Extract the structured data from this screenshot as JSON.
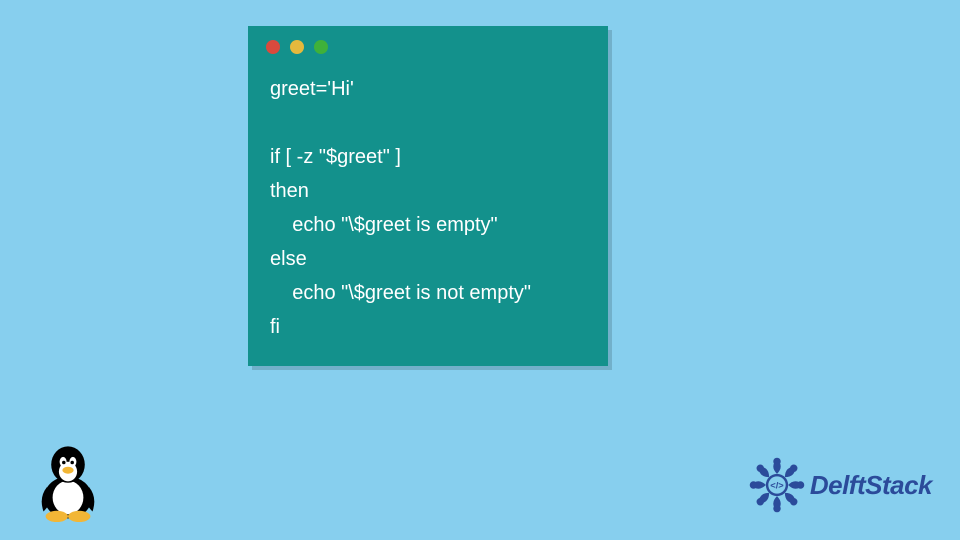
{
  "code": {
    "lines": [
      "greet='Hi'",
      "",
      "if [ -z \"$greet\" ]",
      "then",
      "    echo \"\\$greet is empty\"",
      "else",
      "    echo \"\\$greet is not empty\"",
      "fi"
    ]
  },
  "window": {
    "dot_colors": [
      "#d94a3d",
      "#e5b93d",
      "#3fb13a"
    ]
  },
  "branding": {
    "name": "DelftStack"
  }
}
